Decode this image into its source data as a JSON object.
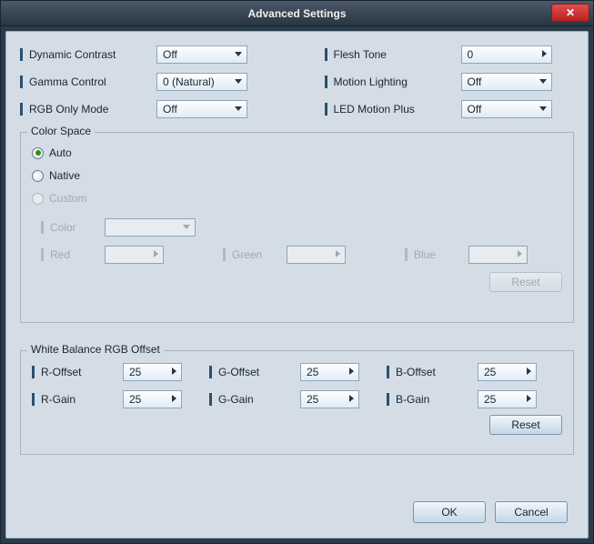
{
  "title": "Advanced Settings",
  "top": {
    "dynamicContrast": {
      "label": "Dynamic Contrast",
      "value": "Off"
    },
    "gammaControl": {
      "label": "Gamma Control",
      "value": "0 (Natural)"
    },
    "rgbOnlyMode": {
      "label": "RGB Only Mode",
      "value": "Off"
    },
    "fleshTone": {
      "label": "Flesh Tone",
      "value": "0"
    },
    "motionLighting": {
      "label": "Motion Lighting",
      "value": "Off"
    },
    "ledMotionPlus": {
      "label": "LED Motion Plus",
      "value": "Off"
    }
  },
  "colorSpace": {
    "legend": "Color Space",
    "options": {
      "auto": "Auto",
      "native": "Native",
      "custom": "Custom"
    },
    "selected": "auto",
    "colorLabel": "Color",
    "red": "Red",
    "green": "Green",
    "blue": "Blue",
    "reset": "Reset"
  },
  "wb": {
    "legend": "White Balance RGB Offset",
    "rOffset": {
      "label": "R-Offset",
      "value": "25"
    },
    "gOffset": {
      "label": "G-Offset",
      "value": "25"
    },
    "bOffset": {
      "label": "B-Offset",
      "value": "25"
    },
    "rGain": {
      "label": "R-Gain",
      "value": "25"
    },
    "gGain": {
      "label": "G-Gain",
      "value": "25"
    },
    "bGain": {
      "label": "B-Gain",
      "value": "25"
    },
    "reset": "Reset"
  },
  "buttons": {
    "ok": "OK",
    "cancel": "Cancel"
  }
}
